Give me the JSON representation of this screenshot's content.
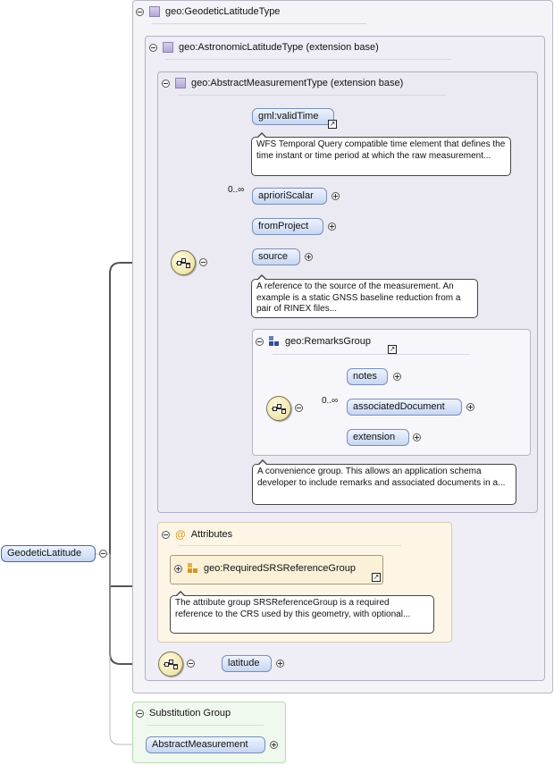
{
  "root_element": {
    "label": "GeodeticLatitude"
  },
  "type_box": {
    "title": "geo:GeodeticLatitudeType"
  },
  "extension_astronomic": {
    "title": "geo:AstronomicLatitudeType (extension base)"
  },
  "extension_abstract": {
    "title": "geo:AbstractMeasurementType (extension base)"
  },
  "elements": {
    "valid_time": {
      "label": "gml:validTime",
      "annotation": "WFS Temporal Query compatible time element that defines the time instant or time period at which the raw measurement..."
    },
    "apriori_scalar": {
      "label": "aprioriScalar",
      "multiplicity": "0..∞"
    },
    "from_project": {
      "label": "fromProject"
    },
    "source": {
      "label": "source",
      "annotation": "A reference to the source of the measurement. An example is a static GNSS baseline reduction from a pair of RINEX files..."
    },
    "latitude": {
      "label": "latitude"
    }
  },
  "remarks_group": {
    "title": "geo:RemarksGroup",
    "annotation": "A convenience group. This allows an application schema developer to include remarks and associated documents in a...",
    "items": {
      "notes": {
        "label": "notes"
      },
      "associated_document": {
        "label": "associatedDocument",
        "multiplicity": "0..∞"
      },
      "extension": {
        "label": "extension"
      }
    }
  },
  "attributes": {
    "title": "Attributes",
    "group_label": "geo:RequiredSRSReferenceGroup",
    "annotation": "The attribute group SRSReferenceGroup is a required reference to the CRS used by this geometry, with optional..."
  },
  "substitution_group": {
    "title": "Substitution Group",
    "element_label": "AbstractMeasurement"
  },
  "colors": {
    "type_icon": "#b4a7d5",
    "element_fill": "#c6d6f2",
    "attributes_bg": "#fdf6e6",
    "substitution_bg": "#f0f9ee"
  },
  "icons": [
    "collapse-icon",
    "type-icon",
    "group-icon",
    "attribute-at-icon",
    "sequence-compositor-icon",
    "expand-icon",
    "link-arrow-icon"
  ]
}
